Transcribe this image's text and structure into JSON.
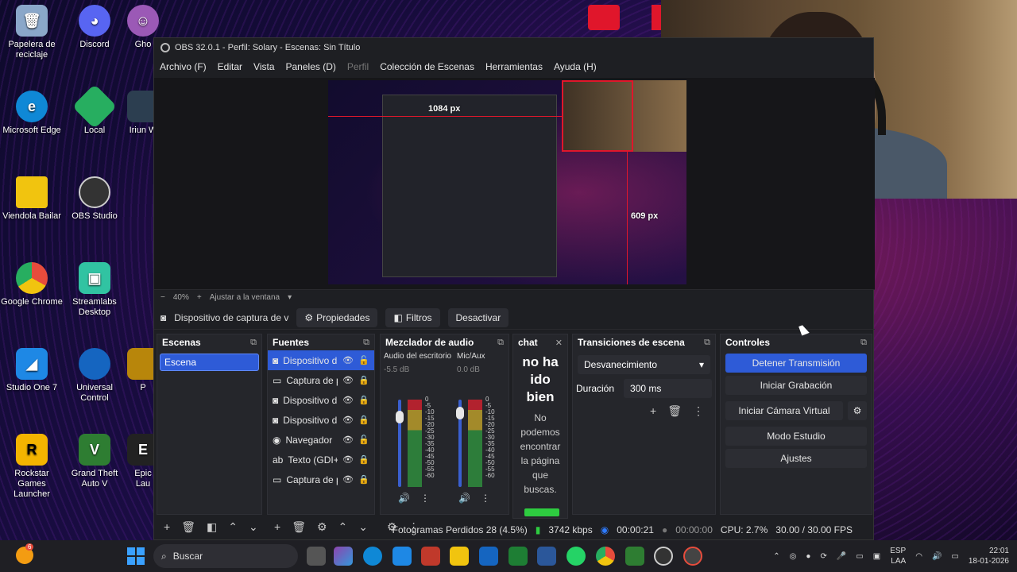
{
  "desktop": {
    "icons": [
      {
        "label": "Papelera de reciclaje",
        "color": "#8aa7c9"
      },
      {
        "label": "Discord",
        "color": "#5865f2"
      },
      {
        "label": "Gho",
        "color": "#9b59b6"
      },
      {
        "label": "Microsoft Edge",
        "color": "#0f88d6"
      },
      {
        "label": "Local",
        "color": "#27ae60"
      },
      {
        "label": "Iriun W",
        "color": "#2c3e50"
      },
      {
        "label": "Viendola Bailar",
        "color": "#f1c40f"
      },
      {
        "label": "OBS Studio",
        "color": "#333333"
      },
      {
        "label": "Google Chrome",
        "color": "#e74c3c"
      },
      {
        "label": "Streamlabs Desktop",
        "color": "#31c3a2"
      },
      {
        "label": "Studio One 7",
        "color": "#1e88e5"
      },
      {
        "label": "Universal Control",
        "color": "#1565c0"
      },
      {
        "label": "P",
        "color": "#b8860b"
      },
      {
        "label": "Rockstar Games Launcher",
        "color": "#f4b400"
      },
      {
        "label": "Grand Theft Auto V",
        "color": "#2e7d32"
      },
      {
        "label": "Epic Lau",
        "color": "#222222"
      }
    ]
  },
  "obs": {
    "title": "OBS 32.0.1 - Perfil: Solary - Escenas: Sin Título",
    "menu": [
      "Archivo (F)",
      "Editar",
      "Vista",
      "Paneles (D)",
      "Perfil",
      "Colección de Escenas",
      "Herramientas",
      "Ayuda (H)"
    ],
    "preview": {
      "width_label": "1084 px",
      "height_label": "609 px"
    },
    "zoom": {
      "minus": "−",
      "value": "40%",
      "plus": "+",
      "fit_label": "Ajustar a la ventana"
    },
    "source_toolbar": {
      "source_name": "Dispositivo de captura de v",
      "properties": "Propiedades",
      "filters": "Filtros",
      "deactivate": "Desactivar"
    },
    "scenes": {
      "title": "Escenas",
      "items": [
        "Escena"
      ]
    },
    "sources": {
      "title": "Fuentes",
      "items": [
        {
          "name": "Dispositivo d",
          "icon": "camera-icon"
        },
        {
          "name": "Captura de p",
          "icon": "window-icon"
        },
        {
          "name": "Dispositivo d",
          "icon": "camera-icon"
        },
        {
          "name": "Dispositivo d",
          "icon": "camera-icon"
        },
        {
          "name": "Navegador",
          "icon": "globe-icon"
        },
        {
          "name": "Texto (GDI+)",
          "icon": "text-icon"
        },
        {
          "name": "Captura de p",
          "icon": "window-icon"
        }
      ]
    },
    "mixer": {
      "title": "Mezclador de audio",
      "channels": [
        {
          "name": "Audio del escritorio",
          "db": "-5.5 dB",
          "level": 0.8
        },
        {
          "name": "Mic/Aux",
          "db": "0.0 dB",
          "level": 0.85
        }
      ],
      "scale": [
        "0",
        "-5",
        "-10",
        "-15",
        "-20",
        "-25",
        "-30",
        "-35",
        "-40",
        "-45",
        "-50",
        "-55",
        "-60"
      ]
    },
    "chat": {
      "title": "chat",
      "heading": "no ha ido bien",
      "message": "No podemos encontrar la página que buscas."
    },
    "transitions": {
      "title": "Transiciones de escena",
      "selected": "Desvanecimiento",
      "duration_label": "Duración",
      "duration_value": "300 ms"
    },
    "controls": {
      "title": "Controles",
      "stop_stream": "Detener Transmisión",
      "start_recording": "Iniciar Grabación",
      "start_virtual_cam": "Iniciar Cámara Virtual",
      "studio_mode": "Modo Estudio",
      "settings": "Ajustes"
    },
    "status": {
      "dropped_frames": "Fotogramas Perdidos 28 (4.5%)",
      "bitrate": "3742 kbps",
      "stream_time": "00:00:21",
      "rec_time": "00:00:00",
      "cpu": "CPU: 2.7%",
      "fps": "30.00 / 30.00 FPS"
    }
  },
  "taskbar": {
    "search_placeholder": "Buscar",
    "language": "ESP",
    "region": "LAA",
    "time": "22:01",
    "date": "18-01-2026",
    "notification_count": "6"
  }
}
